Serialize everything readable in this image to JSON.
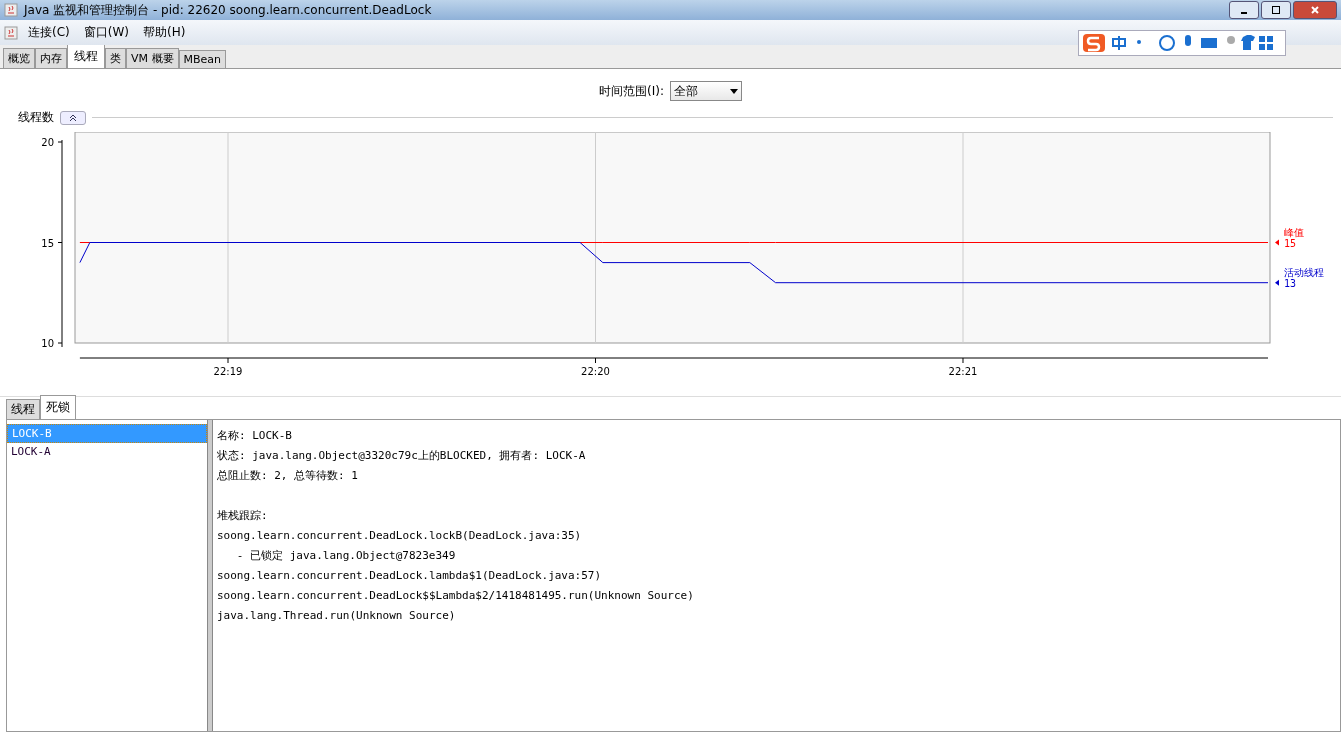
{
  "window": {
    "title": "Java 监视和管理控制台 - pid: 22620 soong.learn.concurrent.DeadLock"
  },
  "menu": [
    "连接(C)",
    "窗口(W)",
    "帮助(H)"
  ],
  "tabs": [
    {
      "label": "概览",
      "selected": false
    },
    {
      "label": "内存",
      "selected": false
    },
    {
      "label": "线程",
      "selected": true
    },
    {
      "label": "类",
      "selected": false
    },
    {
      "label": "VM 概要",
      "selected": false
    },
    {
      "label": "MBean",
      "selected": false
    }
  ],
  "time_range": {
    "label": "时间范围(I):",
    "value": "全部"
  },
  "thread_chart": {
    "title": "线程数",
    "legend_values": [
      "15",
      "13"
    ],
    "chart_data": {
      "type": "line",
      "grid": true,
      "x": [
        22.30995,
        22.3104,
        22.332633,
        22.333667,
        22.340333,
        22.3415,
        22.363833
      ],
      "xlim": [
        22.30995,
        22.363833
      ],
      "ylim": [
        10,
        20
      ],
      "yticks": [
        10,
        15,
        20
      ],
      "xticks": [
        {
          "value": 22.316667,
          "label": "22:19"
        },
        {
          "value": 22.333333,
          "label": "22:20"
        },
        {
          "value": 22.35,
          "label": "22:21"
        }
      ],
      "series": [
        {
          "name": "峰值",
          "color": "#ff0000",
          "values": [
            15,
            15,
            15,
            15,
            15,
            15,
            15
          ]
        },
        {
          "name": "活动线程",
          "color": "#0000cc",
          "values": [
            14,
            15,
            15,
            14,
            14,
            13,
            13
          ]
        }
      ]
    }
  },
  "bottom_tabs": [
    {
      "label": "线程",
      "selected": false
    },
    {
      "label": "死锁",
      "selected": true
    }
  ],
  "threads": [
    {
      "name": "LOCK-B",
      "selected": true
    },
    {
      "name": "LOCK-A",
      "selected": false
    }
  ],
  "details": [
    [
      "名称: LOCK-B",
      "状态: java.lang.Object@3320c79c上的BLOCKED, 拥有者: LOCK-A",
      "总阻止数: 2, 总等待数: 1"
    ],
    [
      "堆栈跟踪:",
      "soong.learn.concurrent.DeadLock.lockB(DeadLock.java:35)",
      "   - 已锁定 java.lang.Object@7823e349",
      "soong.learn.concurrent.DeadLock.lambda$1(DeadLock.java:57)",
      "soong.learn.concurrent.DeadLock$$Lambda$2/1418481495.run(Unknown Source)",
      "java.lang.Thread.run(Unknown Source)"
    ]
  ]
}
